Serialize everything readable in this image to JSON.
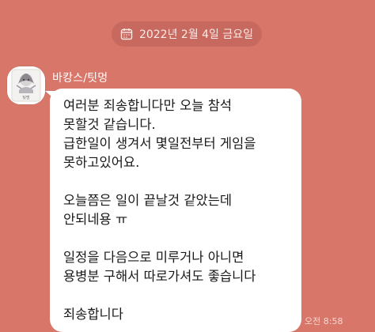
{
  "date_divider": {
    "icon": "calendar-icon",
    "text": "2022년 2월 4일 금요일"
  },
  "message": {
    "sender_name": "바캉스/팃멍",
    "avatar_caption": "팃멍",
    "lines": [
      "여러분 죄송합니다만 오늘 참석",
      "못할것 같습니다.",
      "급한일이 생겨서 몇일전부터 게임을",
      "못하고있어요.",
      "",
      "오늘쯤은 일이 끝날것 같았는데",
      "안되네용 ㅠ",
      "",
      "일정을 다음으로 미루거나 아니면",
      "용병분 구해서 따로가셔도 좋습니다",
      "",
      "죄송합니다"
    ],
    "time": "오전 8:58"
  },
  "colors": {
    "background": "#d9766a",
    "bubble": "#ffffff",
    "date_pill": "#c8695f"
  }
}
